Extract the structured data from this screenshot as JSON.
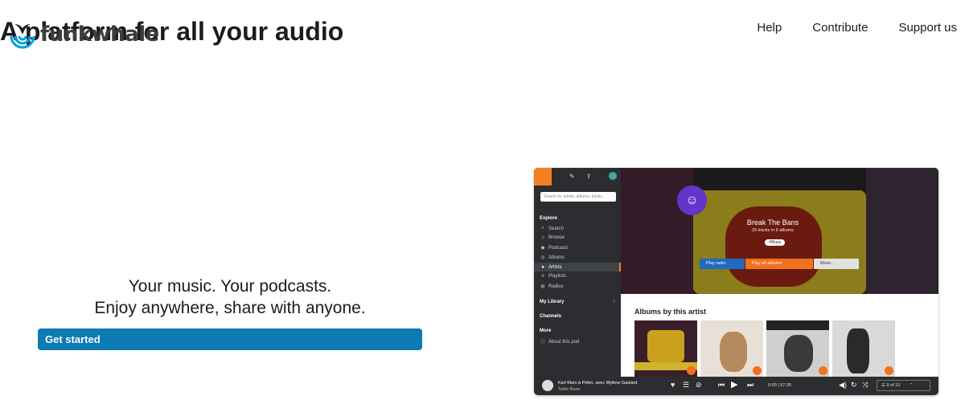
{
  "brand": {
    "name": "funkwhale"
  },
  "nav": {
    "items": [
      "Help",
      "Contribute",
      "Support us"
    ]
  },
  "hero": {
    "title": "A platform for all your audio",
    "tagline_line1": "Your music. Your podcasts.",
    "tagline_line2": "Enjoy anywhere, share with anyone.",
    "cta": "Get started"
  },
  "mock": {
    "search_placeholder": "Search for artists, albums, tracks…",
    "sections": {
      "explore": "Explore",
      "my_library": "My Library",
      "channels": "Channels",
      "more": "More"
    },
    "explore_items": [
      "Search",
      "Browse",
      "Podcasts",
      "Albums",
      "Artists",
      "Playlists",
      "Radios"
    ],
    "more_items": [
      "About this pod"
    ],
    "artist": {
      "name": "Break The Bans",
      "counts": "25 tracks in 6 albums",
      "tag": "#Blues"
    },
    "buttons": {
      "radio": "Play radio",
      "play_all": "Play all albums",
      "more": "More..."
    },
    "albums_heading": "Albums by this artist",
    "player": {
      "track": "Karl Marx à Pékin, avec Mylène Gaulard",
      "album": "Table Rase",
      "time": "0:00 | 57:35",
      "queue": "9 of 10"
    }
  },
  "colors": {
    "accent": "#f47e20",
    "cta": "#0c7ab3",
    "brand_blue": "#009fe3"
  }
}
